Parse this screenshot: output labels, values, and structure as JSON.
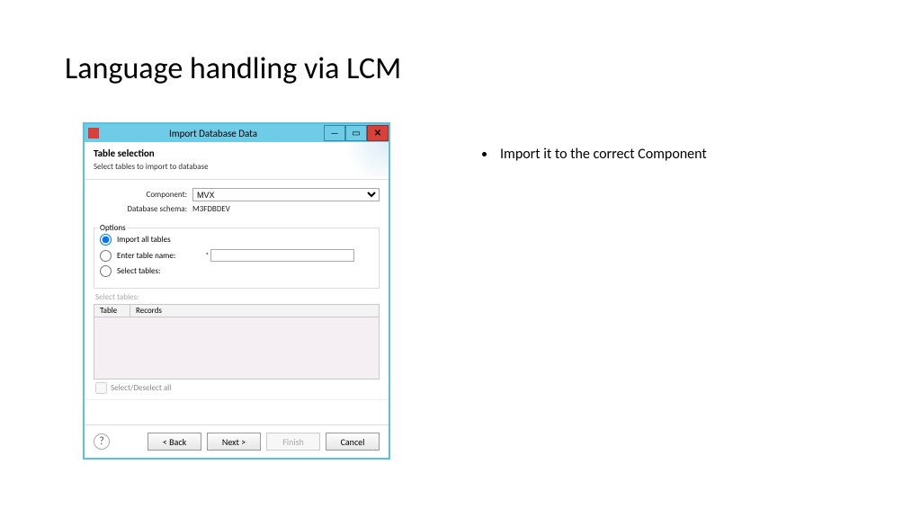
{
  "slide": {
    "title": "Language handling via LCM",
    "bullets": [
      "Import it to the correct Component"
    ]
  },
  "window": {
    "title": "Import Database Data",
    "panel_title": "Table selection",
    "panel_subtitle": "Select tables to import to database",
    "component_label": "Component:",
    "component_value": "MVX",
    "schema_label": "Database schema:",
    "schema_value": "M3FDBDEV",
    "options_legend": "Options",
    "opt_all": "Import all tables",
    "opt_enter": "Enter table name:",
    "opt_select": "Select tables:",
    "st_label": "Select tables:",
    "th_table": "Table",
    "th_records": "Records",
    "selectall": "Select/Deselect all",
    "btn_back": "< Back",
    "btn_next": "Next >",
    "btn_finish": "Finish",
    "btn_cancel": "Cancel"
  }
}
